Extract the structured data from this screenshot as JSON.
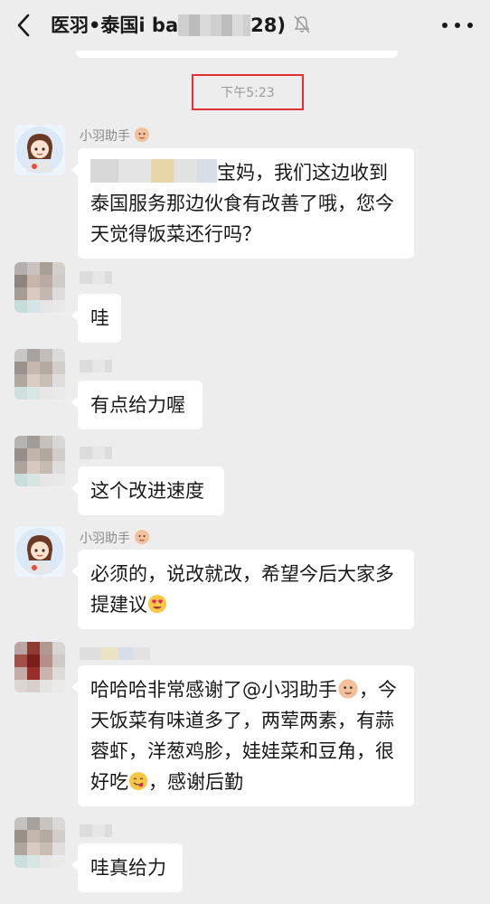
{
  "header": {
    "title_prefix": "医羽•泰国i ba",
    "title_suffix": "28)",
    "icons": [
      "back-icon",
      "mute-icon",
      "more-icon"
    ]
  },
  "chat": {
    "timestamp": "下午5:23",
    "messages": [
      {
        "sender": "小羽助手",
        "sender_badge": "baby-face-icon",
        "text": "宝妈，我们这边收到泰国服务那边伙食有改善了哦，您今天觉得饭菜还行吗？",
        "mention_blurred": true
      },
      {
        "sender": "",
        "text": "哇"
      },
      {
        "sender": "",
        "text": "有点给力喔"
      },
      {
        "sender": "",
        "text": "这个改进速度"
      },
      {
        "sender": "小羽助手",
        "sender_badge": "baby-face-icon",
        "text": "必须的，说改就改，希望今后大家多提建议",
        "trailing_emoji": "heart-eyes-emoji"
      },
      {
        "sender": "",
        "text_parts": [
          "哈哈哈非常感谢了@小羽助手",
          "，今天饭菜有味道多了，两荤两素，有蒜蓉虾，洋葱鸡胗，娃娃菜和豆角，很好吃",
          "，感谢后勤"
        ],
        "inline_emojis": [
          "baby-face-icon",
          "yum-emoji"
        ]
      },
      {
        "sender": "",
        "text": "哇真给力"
      }
    ]
  },
  "colors": {
    "background": "#ededed",
    "bubble": "#ffffff",
    "timestamp_highlight": "#e03232"
  }
}
